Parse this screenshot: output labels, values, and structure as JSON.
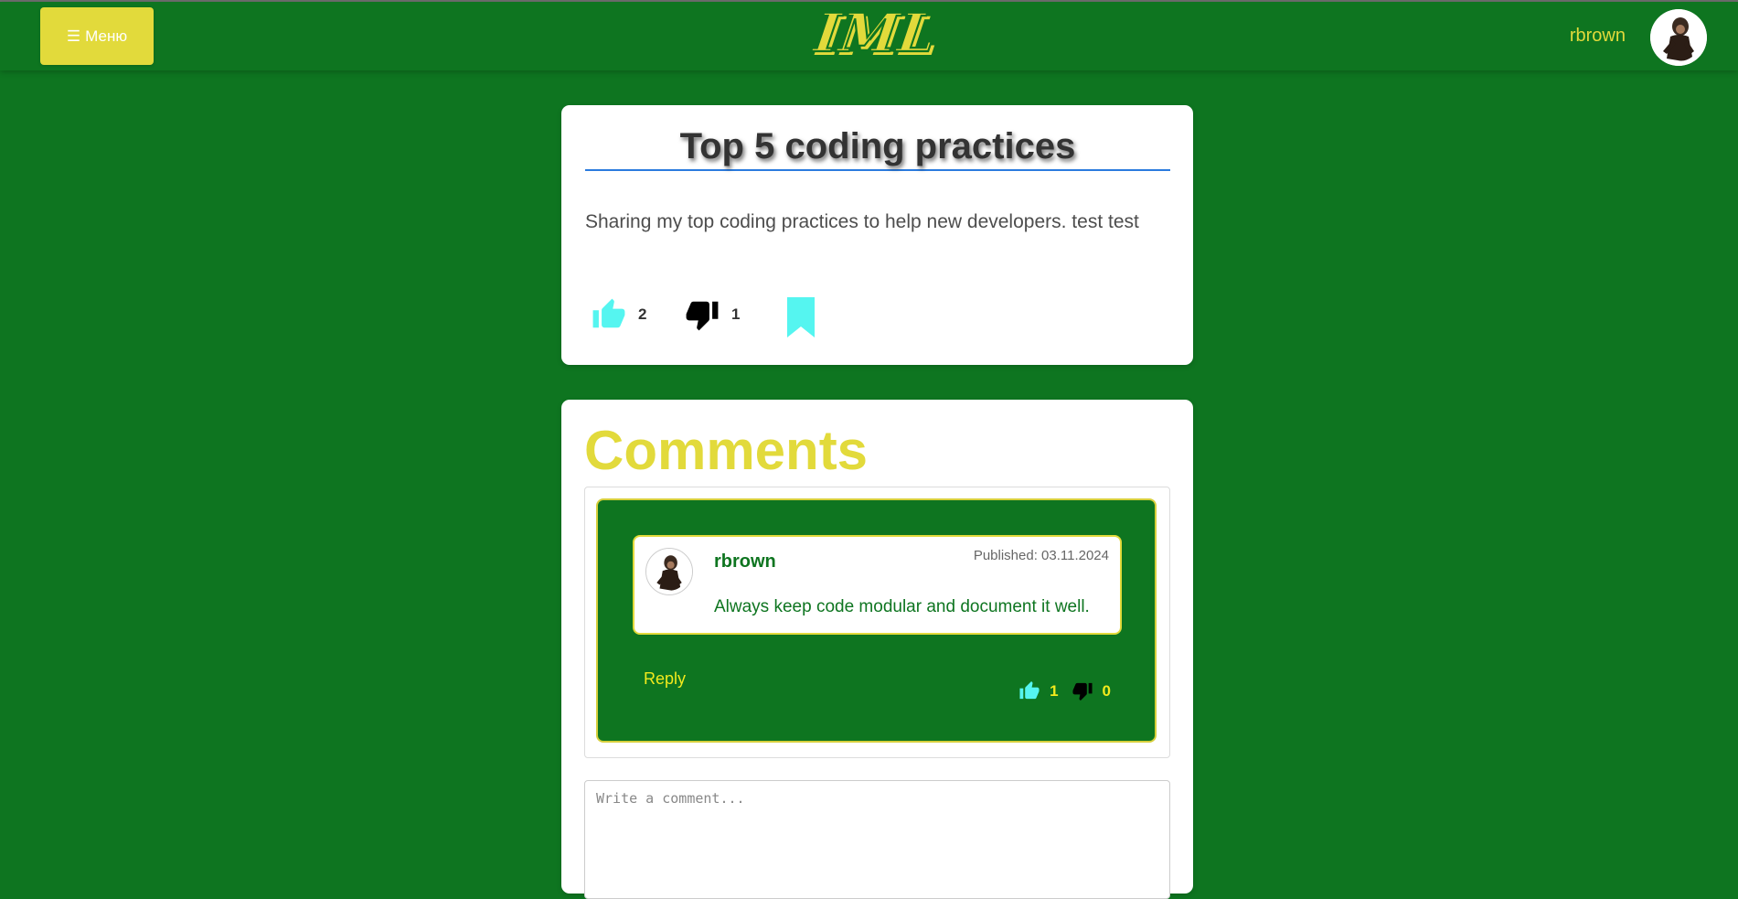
{
  "navbar": {
    "menu_label": "Меню",
    "menu_icon": "hamburger-icon",
    "logo_text": "IML",
    "username": "rbrown",
    "avatar": "chimpanzee-avatar"
  },
  "post": {
    "title": "Top 5 coding practices",
    "body": "Sharing my top coding practices to help new developers. test test",
    "likes": "2",
    "dislikes": "1",
    "like_icon": "thumbs-up-icon",
    "dislike_icon": "thumbs-down-icon",
    "bookmark_icon": "bookmark-icon"
  },
  "comments": {
    "heading": "Comments",
    "items": [
      {
        "author": "rbrown",
        "published": "Published: 03.11.2024",
        "text": "Always keep code modular and document it well.",
        "reply_label": "Reply",
        "likes": "1",
        "dislikes": "0"
      }
    ],
    "input_placeholder": "Write a comment..."
  },
  "colors": {
    "background": "#0e7520",
    "accent_yellow": "#e2da3b",
    "bright_yellow": "#f2ea1d",
    "like_cyan": "#55f5f0",
    "title_underline": "#2b7bde"
  }
}
